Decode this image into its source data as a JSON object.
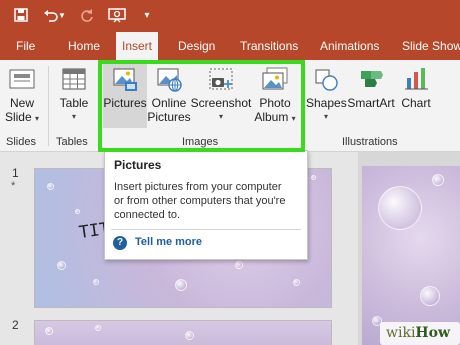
{
  "qat": {
    "icons": [
      "save-icon",
      "undo-icon",
      "undo-dropdown-icon",
      "redo-icon",
      "present-icon",
      "customize-dropdown-icon"
    ]
  },
  "tabs": [
    "File",
    "Home",
    "Insert",
    "Design",
    "Transitions",
    "Animations",
    "Slide Show"
  ],
  "ribbon": {
    "new_slide": [
      "New",
      "Slide"
    ],
    "table": "Table",
    "pictures": "Pictures",
    "online_pictures": [
      "Online",
      "Pictures"
    ],
    "screenshot": "Screenshot",
    "photo_album": [
      "Photo",
      "Album"
    ],
    "shapes": "Shapes",
    "smartart": "SmartArt",
    "chart": "Chart",
    "groups": {
      "slides": "Slides",
      "tables": "Tables",
      "images": "Images",
      "illustrations": "Illustrations"
    }
  },
  "tooltip": {
    "title": "Pictures",
    "body": [
      "Insert pictures from your computer",
      "or from other computers that you're",
      "connected to."
    ],
    "link": "Tell me more"
  },
  "slides": {
    "numbers": [
      "1",
      "2"
    ],
    "marker": "*",
    "title_fragment": "TIT"
  },
  "watermark": {
    "wiki": "wiki",
    "how": "How"
  },
  "colors": {
    "accent": "#b7472a",
    "highlight": "#3adb1e",
    "help_blue": "#1f5f9e"
  }
}
